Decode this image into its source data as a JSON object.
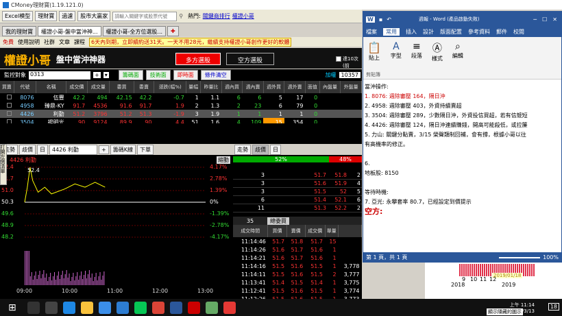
{
  "window": {
    "title": "CMoney理財寶(1.19.121.0)"
  },
  "toolbar": {
    "items": [
      "Excel模型",
      "理財寶",
      "過濾",
      "股市大贏家"
    ],
    "search_placeholder": "請輸入關鍵字或股票代號",
    "hot_label": "熱門:",
    "hot_links": [
      "關鍵商排行",
      "權證小哥"
    ]
  },
  "tabs": [
    {
      "label": "我的理財寶"
    },
    {
      "label": "權證小哥-盤中當沖神..."
    },
    {
      "label": "權證小哥-全方位選股..."
    }
  ],
  "subbar": {
    "items": [
      "免費",
      "使用說明",
      "社群",
      "文章",
      "課程"
    ],
    "marquee": "6天內到期，立即續約送31天。一天不用28元，繼續支持權證小哥創作更好的軟體"
  },
  "banner": {
    "brand": "權證小哥",
    "product": "盤中當沖神器",
    "btn_long": "多方選股",
    "btn_short": "空方選股",
    "reset_label": "達10次(前"
  },
  "control": {
    "label": "監控對象",
    "value": "0313",
    "btns": [
      "籌碼面",
      "技術面",
      "即時面",
      "條件清空"
    ],
    "count_label": "加權",
    "count_value": "10357"
  },
  "table": {
    "headers": [
      "買賣",
      "代號",
      "名稱",
      "成交價",
      "成交量",
      "委買",
      "委賣",
      "漲跌(幅%)",
      "量幅",
      "昨量比",
      "週內買",
      "週內賣",
      "週外買",
      "週外賣",
      "面值",
      "內盤量",
      "外盤量"
    ],
    "rows": [
      [
        "",
        "8076",
        "伍豐",
        "42.2",
        "494",
        "42.15",
        "42.2",
        "-0.7",
        "1",
        "1.1",
        "6",
        "6",
        "5",
        "17",
        "0",
        "",
        ""
      ],
      [
        "",
        "4958",
        "臻鼎-KY",
        "91.7",
        "4536",
        "91.6",
        "91.7",
        "1.9",
        "2",
        "1.3",
        "2",
        "23",
        "6",
        "79",
        "0",
        "",
        ""
      ],
      [
        "",
        "4426",
        "利勤",
        "51.2",
        "3796",
        "51.2",
        "51.3",
        "-1.9",
        "3",
        "1.9",
        "1",
        "1",
        "1",
        "1",
        "0",
        "",
        ""
      ],
      [
        "",
        "3504",
        "揚明光",
        "90",
        "9124",
        "89.9",
        "90",
        "4.4",
        "51",
        "1.6",
        "4",
        "109",
        "15",
        "354",
        "0",
        "",
        ""
      ]
    ]
  },
  "chart": {
    "toolbar": [
      "走勢",
      "歧價",
      "日"
    ],
    "stock_select": "4426 利勤",
    "btn_k": "籌碼K線",
    "btn_next": "下單",
    "mode": "縮動",
    "side_label": "打開左側清單",
    "y_left": [
      "52.4",
      "51.7",
      "51.0",
      "50.3",
      "49.6",
      "48.9",
      "48.2"
    ],
    "y_right": [
      "4.17%",
      "2.78%",
      "1.39%",
      "0%",
      "-1.39%",
      "-2.78%",
      "-4.17%"
    ],
    "x_labels": [
      "09:00",
      "10:00",
      "11:00",
      "12:00",
      "13:00"
    ],
    "high_label": "52.4",
    "title_red": "4426 利勤"
  },
  "chart_data": {
    "type": "line",
    "x": [
      "09:00",
      "10:00",
      "11:00",
      "12:00",
      "13:00"
    ],
    "ylim": [
      48.2,
      52.4
    ],
    "points": [
      [
        0,
        50.3
      ],
      [
        4,
        51.2
      ],
      [
        8,
        52.4
      ],
      [
        12,
        51.6
      ],
      [
        20,
        50.9
      ],
      [
        30,
        51.2
      ],
      [
        40,
        50.8
      ],
      [
        60,
        51.1
      ],
      [
        75,
        51.4
      ],
      [
        90,
        51.2
      ],
      [
        105,
        51.5
      ],
      [
        115,
        51.3
      ],
      [
        120,
        51.2
      ]
    ]
  },
  "book": {
    "bid_pct": "52%",
    "ask_pct": "48%",
    "rows": [
      [
        "3",
        "51.7",
        "51.8",
        "2"
      ],
      [
        "3",
        "51.6",
        "51.9",
        "4"
      ],
      [
        "3",
        "51.5",
        "52",
        "5"
      ],
      [
        "6",
        "51.4",
        "52.1",
        "6"
      ],
      [
        "11",
        "51.3",
        "52.2",
        "2"
      ]
    ]
  },
  "trade": {
    "count": "35",
    "label": "總委買",
    "headers": [
      "成交時間",
      "買價",
      "賣價",
      "成交價",
      "單量"
    ],
    "rows": [
      [
        "11:14:46",
        "51.7",
        "51.8",
        "51.7",
        "15",
        ""
      ],
      [
        "11:14:26",
        "51.6",
        "51.7",
        "51.6",
        "1",
        ""
      ],
      [
        "11:14:21",
        "51.6",
        "51.7",
        "51.6",
        "1",
        ""
      ],
      [
        "11:14:16",
        "51.5",
        "51.6",
        "51.5",
        "1",
        "3,778"
      ],
      [
        "11:14:11",
        "51.5",
        "51.6",
        "51.5",
        "2",
        "3,777"
      ],
      [
        "11:13:41",
        "51.4",
        "51.5",
        "51.4",
        "1",
        "3,775"
      ],
      [
        "11:12:41",
        "51.5",
        "51.6",
        "51.5",
        "1",
        "3,774"
      ],
      [
        "11:12:26",
        "51.5",
        "51.6",
        "51.5",
        "1",
        "3,773"
      ]
    ]
  },
  "word": {
    "title": "週報 - Word (產品啟動失敗)",
    "tabs": [
      "檔案",
      "常用",
      "插入",
      "設計",
      "版面配置",
      "參考資料",
      "郵件",
      "校閱"
    ],
    "ribbon": [
      "貼上",
      "字型",
      "段落",
      "樣式",
      "編輯",
      "剪貼簿"
    ],
    "lines": [
      {
        "t": "當沖操作:",
        "c": ""
      },
      {
        "t": "1.  8076: 週除審壓 164，隔日沖",
        "c": "red"
      },
      {
        "t": "2.  4958: 週除審壓 403，外資持續賣超",
        "c": ""
      },
      {
        "t": "3.  3504: 週除審壓 289，少數隔日沖，外資投信買超，若有信競短",
        "c": ""
      },
      {
        "t": "4.  4426: 週除審壓 124，隔日沖連續賺錢，開高可能殺低，或拉簾",
        "c": ""
      },
      {
        "t": "5.  力山: 關鍵分點賣，3/15 榮聲類制回補，會有撐，根據小哥以往",
        "c": ""
      },
      {
        "t": "     有高機率的修正。",
        "c": ""
      },
      {
        "t": "",
        "c": ""
      },
      {
        "t": "6.",
        "c": ""
      },
      {
        "t": "地板股: 8150",
        "c": ""
      },
      {
        "t": "",
        "c": ""
      },
      {
        "t": "等待時機:",
        "c": ""
      },
      {
        "t": "7.  亞光: 永攀套率 80.7，已經設定到價提示",
        "c": ""
      },
      {
        "t": "空方:",
        "c": "bold"
      }
    ],
    "status": "第 1 頁，共 1 頁",
    "zoom": "100%"
  },
  "behind": {
    "years": [
      "2018",
      "2019"
    ],
    "nums": [
      "9",
      "10",
      "11",
      "12"
    ],
    "date": "2019/01/18"
  },
  "taskbar": {
    "time": "上午 11:14",
    "date": "2019/3/13",
    "notify": "顯示隱藏的圖示",
    "badge": "18"
  }
}
